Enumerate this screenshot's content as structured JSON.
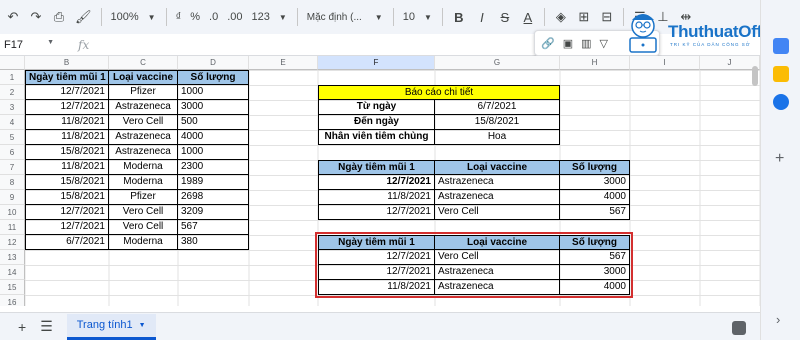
{
  "toolbar": {
    "zoom": "100%",
    "currency": "₫",
    "percent": "%",
    "dec_less": ".0",
    "dec_more": ".00",
    "number_format": "123",
    "font": "Mặc định (...",
    "font_size": "10",
    "bold": "B",
    "italic": "I",
    "strike": "S",
    "text_color": "A"
  },
  "namebox": "F17",
  "fx": "fx",
  "brand": {
    "name": "ThuthuatOffice",
    "tagline": "TRI KỸ CỦA DÂN CÔNG SỞ"
  },
  "columns": [
    "B",
    "C",
    "D",
    "E",
    "F",
    "G",
    "H",
    "I",
    "J"
  ],
  "rows": [
    "1",
    "2",
    "3",
    "4",
    "5",
    "6",
    "7",
    "8",
    "9",
    "10",
    "11",
    "12",
    "13",
    "14",
    "15",
    "16",
    "17"
  ],
  "source_table": {
    "headers": [
      "Ngày tiêm mũi 1",
      "Loại vaccine",
      "Số lượng"
    ],
    "rows": [
      [
        "12/7/2021",
        "Pfizer",
        "1000"
      ],
      [
        "12/7/2021",
        "Astrazeneca",
        "3000"
      ],
      [
        "11/8/2021",
        "Vero Cell",
        "500"
      ],
      [
        "11/8/2021",
        "Astrazeneca",
        "4000"
      ],
      [
        "15/8/2021",
        "Astrazeneca",
        "1000"
      ],
      [
        "11/8/2021",
        "Moderna",
        "2300"
      ],
      [
        "15/8/2021",
        "Moderna",
        "1989"
      ],
      [
        "15/8/2021",
        "Pfizer",
        "2698"
      ],
      [
        "12/7/2021",
        "Vero Cell",
        "3209"
      ],
      [
        "12/7/2021",
        "Vero Cell",
        "567"
      ],
      [
        "6/7/2021",
        "Moderna",
        "380"
      ]
    ]
  },
  "report": {
    "title": "Báo cáo chi tiết",
    "rows": [
      [
        "Từ ngày",
        "6/7/2021"
      ],
      [
        "Đến ngày",
        "15/8/2021"
      ],
      [
        "Nhân viên tiêm chủng",
        "Hoa"
      ]
    ]
  },
  "result_table_1": {
    "headers": [
      "Ngày tiêm mũi 1",
      "Loại vaccine",
      "Số lượng"
    ],
    "rows": [
      [
        "12/7/2021",
        "Astrazeneca",
        "3000"
      ],
      [
        "11/8/2021",
        "Astrazeneca",
        "4000"
      ],
      [
        "12/7/2021",
        "Vero Cell",
        "567"
      ]
    ]
  },
  "result_table_2": {
    "headers": [
      "Ngày tiêm mũi 1",
      "Loại vaccine",
      "Số lượng"
    ],
    "rows": [
      [
        "12/7/2021",
        "Vero Cell",
        "567"
      ],
      [
        "12/7/2021",
        "Astrazeneca",
        "3000"
      ],
      [
        "11/8/2021",
        "Astrazeneca",
        "4000"
      ]
    ]
  },
  "sheet_tab": "Trang tính1",
  "colors": {
    "header_blue": "#9fc5e8",
    "highlight_yellow": "#ffff00",
    "red_outline": "#d32f2f",
    "brand_blue": "#1a73c8"
  }
}
